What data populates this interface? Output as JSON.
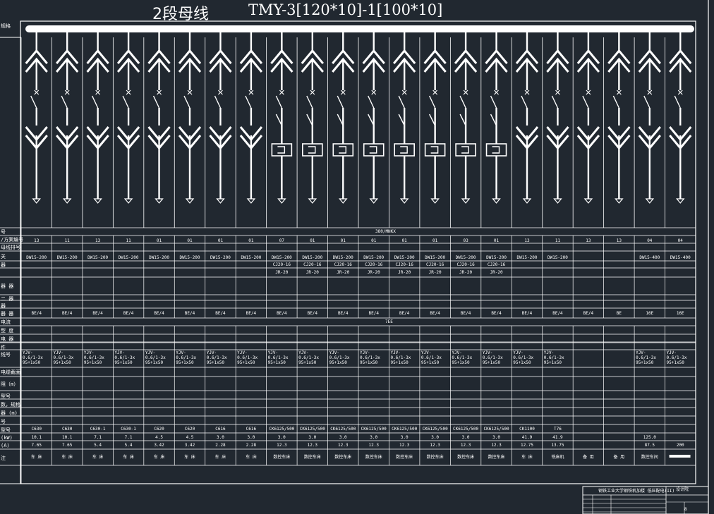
{
  "title": {
    "busbar_name": "2段母线",
    "spec": "TMY-3[120*10]-1[100*10]"
  },
  "row_labels": [
    "规格",
    "号",
    "/方案编号",
    "母线排号",
    "关",
    "器",
    "器 器",
    "二 器",
    "器",
    "器 器",
    "电流",
    "型 度",
    "电 器",
    "件",
    "线号",
    "电缆截面",
    "阻（m）",
    "型号",
    "数，规格",
    "器 (m)",
    "号",
    "型号",
    "(kW)",
    "(A)",
    "注"
  ],
  "system_label": "380/MNKX",
  "middle_label": "7EE",
  "scheme_ids": [
    "13",
    "11",
    "13",
    "11",
    "01",
    "01",
    "01",
    "01",
    "07",
    "01",
    "01",
    "01",
    "01",
    "01",
    "03",
    "01",
    "13",
    "11",
    "13",
    "13",
    "04",
    "04"
  ],
  "breakers": [
    "DW15-200",
    "DW15-200",
    "DW15-200",
    "DW15-200",
    "DW15-200",
    "DW15-200",
    "DW15-200",
    "DW15-200",
    "DW15-200",
    "DW15-200",
    "DW15-200",
    "DW15-200",
    "DW15-200",
    "DW15-200",
    "DW15-200",
    "DW15-200",
    "DW15-200",
    "DW15-200",
    "",
    "",
    "DW15-400",
    "DW15-400"
  ],
  "contactors": [
    "",
    "",
    "",
    "",
    "",
    "",
    "",
    "",
    "CJ20-16",
    "CJ20-16",
    "CJ20-16",
    "CJ20-16",
    "CJ20-16",
    "CJ20-16",
    "CJ20-16",
    "CJ20-16",
    "",
    "",
    "",
    "",
    "",
    ""
  ],
  "relays": [
    "",
    "",
    "",
    "",
    "",
    "",
    "",
    "",
    "JR-20",
    "JR-20",
    "JR-20",
    "JR-20",
    "JR-20",
    "JR-20",
    "JR-20",
    "JR-20",
    "",
    "",
    "",
    "",
    "",
    ""
  ],
  "ct": [
    "BE/4",
    "BE/4",
    "BE/4",
    "BE/4",
    "BE/4",
    "BE/4",
    "BE/4",
    "BE/4",
    "BE/4",
    "BE/4",
    "BE/4",
    "BE/4",
    "BE/4",
    "BE/4",
    "BE/4",
    "BE/4",
    "BE/4",
    "BE/4",
    "BE/4",
    "BE",
    "16E",
    "16E"
  ],
  "cables": [
    "YJV-\n0.6/1-3x\n95+1x50",
    "YJV-\n0.6/1-3x\n95+1x50",
    "YJV-\n0.6/1-3x\n95+1x50",
    "YJV-\n0.6/1-3x\n95+1x50",
    "YJV-\n0.6/1-3x\n95+1x50",
    "YJV-\n0.6/1-3x\n95+1x50",
    "YJV-\n0.6/1-3x\n95+1x50",
    "YJV-\n0.6/1-3x\n95+1x50",
    "YJV-\n0.6/1-3x\n95+1x50",
    "YJV-\n0.6/1-3x\n95+1x50",
    "YJV-\n0.6/1-3x\n95+1x50",
    "YJV-\n0.6/1-3x\n95+1x50",
    "YJV-\n0.6/1-3x\n95+1x50",
    "YJV-\n0.6/1-3x\n95+1x50",
    "YJV-\n0.6/1-3x\n95+1x50",
    "YJV-\n0.6/1-3x\n95+1x50",
    "YJV-\n0.6/1-3x\n95+1x50",
    "YJV-\n0.6/1-3x\n95+1x50",
    "",
    "",
    "YJV-\n0.6/1-3x\n95+1x50",
    "YJV-\n0.6/1-3x\n95+1x50"
  ],
  "equip_types": [
    "C630",
    "C630",
    "C630-1",
    "C630-1",
    "C620",
    "C620",
    "C616",
    "C616",
    "CK6125/500",
    "CK6125/500",
    "CK6125/500",
    "CK6125/500",
    "CK6125/500",
    "CK6125/500",
    "CK6125/500",
    "CK6125/500",
    "CK1100",
    "T76",
    "",
    "",
    "",
    ""
  ],
  "power_kw": [
    "10.1",
    "10.1",
    "7.1",
    "7.1",
    "4.5",
    "4.5",
    "3.0",
    "3.0",
    "3.0",
    "3.0",
    "3.0",
    "3.0",
    "3.0",
    "3.0",
    "3.0",
    "3.0",
    "41.9",
    "41.9",
    "",
    "",
    "125.0",
    ""
  ],
  "current_a": [
    "7.65",
    "7.65",
    "5.4",
    "5.4",
    "3.42",
    "3.42",
    "2.28",
    "2.28",
    "12.3",
    "12.3",
    "12.3",
    "12.3",
    "12.3",
    "12.3",
    "12.3",
    "12.3",
    "12.75",
    "13.75",
    "",
    "",
    "87.5",
    "200"
  ],
  "remarks": [
    "车 床",
    "车 床",
    "车 床",
    "车 床",
    "车 床",
    "车 床",
    "车 床",
    "车 床",
    "数控车床",
    "数控车床",
    "数控车床",
    "数控车床",
    "数控车床",
    "数控车床",
    "数控车床",
    "数控车床",
    "车 床",
    "铣床机",
    "备 用",
    "备 用",
    "数控车间",
    ""
  ],
  "title_block": {
    "project": "钢铁工业大学钢铁机加楼 低压配电(II)",
    "company": "设计院",
    "sheet": "8"
  },
  "colors": {
    "background": "#212830",
    "line": "#ffffff",
    "text": "#ffffff"
  }
}
